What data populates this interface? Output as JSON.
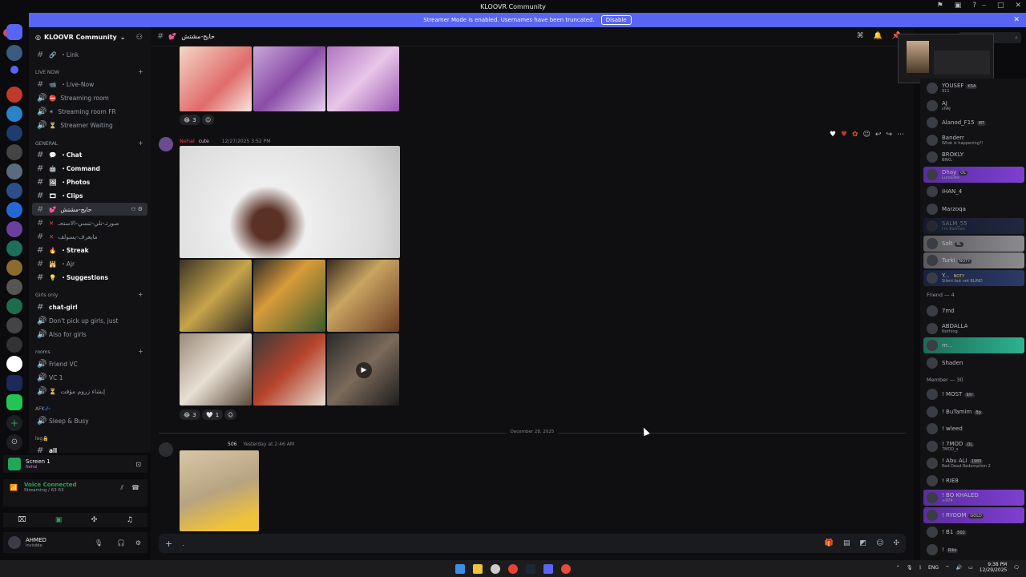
{
  "window": {
    "title": "KLOOVR Community",
    "controls": [
      "⎯",
      "□",
      "✕"
    ]
  },
  "banner": {
    "text": "Streamer Mode is enabled. Usernames have been truncated.",
    "button": "Disable"
  },
  "servers": {
    "new_label": "NEW"
  },
  "guild": {
    "name": "KLOOVR Community"
  },
  "sidebar": {
    "link": "・Link",
    "cat_live": "LIVE NOW",
    "live_now": "・Live-Now",
    "streaming_room": "Streaming room",
    "streaming_fr": "Streaming room FR",
    "streamer_waiting": "Streamer Waiting",
    "cat_general": "GENERAL",
    "chat": "・Chat",
    "command": "・Command",
    "photos": "・Photos",
    "clips": "・Clips",
    "active_channel": "حايح-مشتش",
    "arabic1": "صورتـ-تلي-تنسي-الاستحـ",
    "arabic2": "مايعرف-يسولف",
    "streak": "・Streak",
    "ajr": "・Ajr",
    "suggestions": "・Suggestions",
    "cat_girls": "Girls only",
    "chat_girl": "chat-girl",
    "dont_pick": "Don't pick up girls, just",
    "also_girls": "Also for girls",
    "cat_rooms": "rooms",
    "friend_vc": "Friend VC",
    "vc1": "VC 1",
    "arabic3": "إنشاء زروم مؤقت",
    "cat_afk": "AFK💤",
    "sleep_busy": "Sleep & Busy",
    "cat_log": "log🔒",
    "all": "all"
  },
  "screen": {
    "title": "Screen 1",
    "sub": "Nehal"
  },
  "voice": {
    "status": "Voice Connected",
    "detail": "Streaming / 63 63"
  },
  "user": {
    "name": "AHMED",
    "status": "Invisible"
  },
  "chat_header": {
    "channel": "حايح-مشتش"
  },
  "messages": [
    {
      "author": "Nehal",
      "badge": "cute",
      "time": "12/27/2025 3:52 PM",
      "reactions": [
        {
          "emoji": "😂",
          "count": "3"
        },
        {
          "emoji": "🤍",
          "count": "1"
        }
      ]
    },
    {
      "author": "",
      "badge": "506",
      "time": "Yesterday at 2:46 AM"
    }
  ],
  "top_reaction": {
    "emoji": "😂",
    "count": "3"
  },
  "divider": "December 28, 2025",
  "composer": {
    "placeholder": "."
  },
  "members": {
    "top": [
      {
        "name": "YOUSEF",
        "sub": "911",
        "tag": "KSA"
      },
      {
        "name": "AJ",
        "sub": "shAJ"
      },
      {
        "name": "Alanod_F15",
        "tag": "MT"
      },
      {
        "name": "Banderr",
        "sub": "What is happening?!"
      },
      {
        "name": "BROKLY",
        "sub": "BRKL"
      },
      {
        "name": "Dhay",
        "sub": "LunaDee",
        "tag": "OL"
      },
      {
        "name": "iHAN_4"
      },
      {
        "name": "Marzoqa"
      },
      {
        "name": "SALM_55",
        "sub": "I'm Batman"
      },
      {
        "name": "Solt",
        "tag": "RL"
      },
      {
        "name": "Turki",
        "tag": "NOTY"
      },
      {
        "name": "Y...",
        "sub": "Silent but not BLIND",
        "tag": "NOTY"
      }
    ],
    "friend_section": "Friend — 4",
    "friends": [
      {
        "name": "7md"
      },
      {
        "name": "ABDALLA",
        "sub": "Nothing."
      },
      {
        "name": "m..."
      },
      {
        "name": "Shaden"
      }
    ],
    "member_section": "Member — 30",
    "member_list": [
      {
        "name": "! MOST",
        "tag": "9/ir"
      },
      {
        "name": "! BuTamim",
        "tag": "Bp"
      },
      {
        "name": "! wleed"
      },
      {
        "name": "! 7MOD",
        "sub": "7MOD_s",
        "tag": "OL"
      },
      {
        "name": "! Abu ALI",
        "sub": "Red Dead Redemption 2",
        "tag": "1980"
      },
      {
        "name": "! RIE8"
      },
      {
        "name": "! BO KHALED",
        "sub": "+974"
      },
      {
        "name": "! RYOOM",
        "tag": "GOLD"
      },
      {
        "name": "! B1",
        "tag": "502"
      },
      {
        "name": "!",
        "tag": "Riko"
      }
    ]
  },
  "taskbar": {
    "lang": "ENG",
    "time": "9:38 PM",
    "date": "12/29/2025"
  },
  "colors": {
    "accent": "#5865f2",
    "online": "#23a55a",
    "mention": "#f23f43"
  }
}
